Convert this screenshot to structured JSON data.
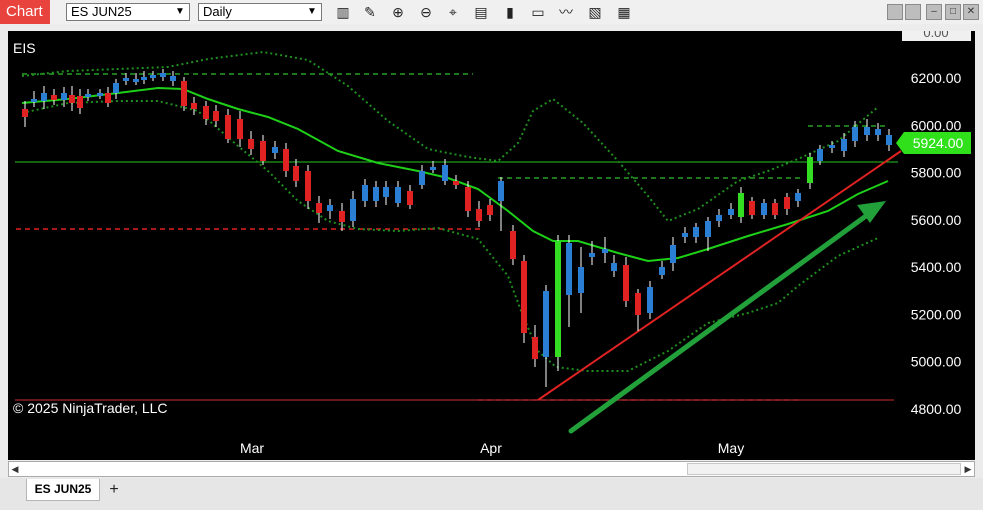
{
  "window": {
    "chart_tab_label": "Chart",
    "instrument": "ES JUN25",
    "period": "Daily"
  },
  "toolbar": {
    "icons": [
      "bars-type-icon",
      "draw-pencil-icon",
      "zoom-in-icon",
      "zoom-out-icon",
      "crosshair-icon",
      "data-box-icon",
      "indicators-icon",
      "strategies-icon",
      "drawing-tools-icon",
      "templates-icon",
      "properties-icon"
    ],
    "glyphs": [
      "▥",
      "✎",
      "⊕",
      "⊖",
      "⌖",
      "▤",
      "▮",
      "▭",
      "〰",
      "▧",
      "▦"
    ]
  },
  "window_buttons": {
    "glyphs": [
      "",
      "",
      "–",
      "□",
      "✕"
    ]
  },
  "plot": {
    "instrument_label": "EIS",
    "copyright": "© 2025 NinjaTrader, LLC",
    "top_partial_label": "0.00",
    "price_labels": [
      "6200.00",
      "6000.00",
      "5800.00",
      "5600.00",
      "5400.00",
      "5200.00",
      "5000.00",
      "4800.00"
    ],
    "current_price": "5924.00",
    "month_labels": [
      "Mar",
      "Apr",
      "May"
    ],
    "colors": {
      "up": "#2a7fd4",
      "down": "#e02222",
      "signal_up": "#33dd22",
      "ma": "#1ed018",
      "bands": "#1f8f1f",
      "trend": "#e02222",
      "arrow": "#22a03a",
      "level_line": "#23c423"
    }
  },
  "chart_data": {
    "type": "candlestick",
    "yscale_ticks": [
      6200,
      6000,
      5800,
      5600,
      5400,
      5200,
      5000,
      4800
    ],
    "last_price": 5924
  },
  "tabs": {
    "active": "ES JUN25",
    "add": "+"
  }
}
